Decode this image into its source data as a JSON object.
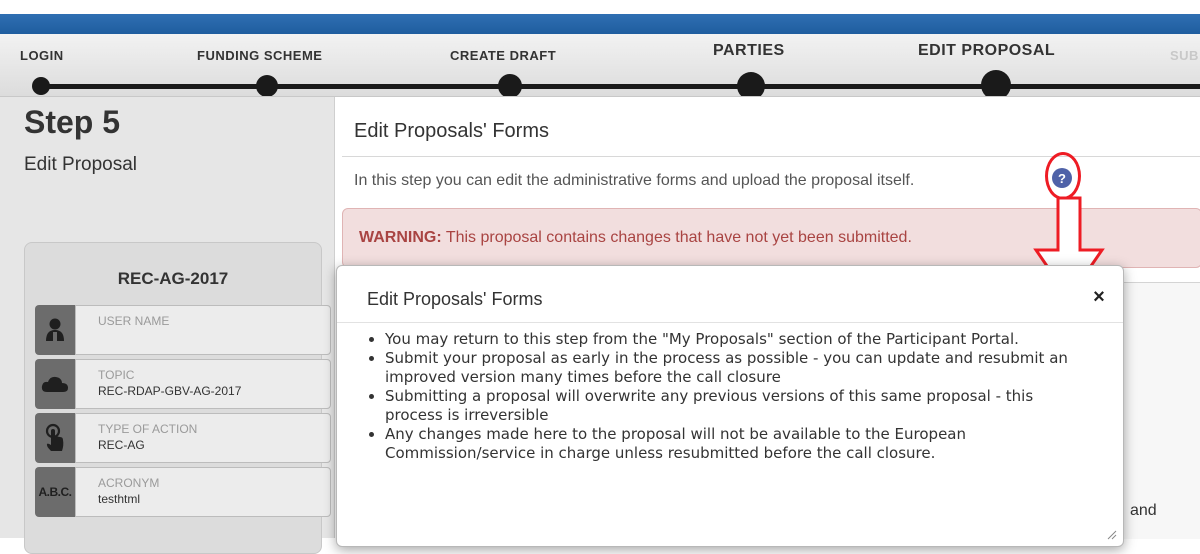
{
  "wizard": {
    "steps": [
      {
        "label": "LOGIN"
      },
      {
        "label": "FUNDING SCHEME"
      },
      {
        "label": "CREATE DRAFT"
      },
      {
        "label": "PARTIES"
      },
      {
        "label": "EDIT PROPOSAL"
      },
      {
        "label": "SUB"
      }
    ]
  },
  "sidebar": {
    "step_title": "Step 5",
    "step_subtitle": "Edit Proposal",
    "card": {
      "code": "REC-AG-2017",
      "fields": [
        {
          "icon": "user-icon",
          "label": "USER NAME",
          "value": ""
        },
        {
          "icon": "cloud-icon",
          "label": "TOPIC",
          "value": "REC-RDAP-GBV-AG-2017"
        },
        {
          "icon": "touch-icon",
          "label": "TYPE OF ACTION",
          "value": "REC-AG"
        },
        {
          "icon": "abc-icon",
          "label": "ACRONYM",
          "value": "testhtml",
          "icon_text": "A.B.C."
        }
      ]
    }
  },
  "main": {
    "title": "Edit Proposals' Forms",
    "description": "In this step you can edit the administrative forms and upload the proposal itself.",
    "warning_label": "WARNING:",
    "warning_text": "This proposal contains changes that have not yet been submitted.",
    "trailing_text": "and"
  },
  "modal": {
    "title": "Edit Proposals' Forms",
    "close_glyph": "×",
    "items": [
      "You may return to this step from the \"My Proposals\" section of the Participant Portal.",
      "Submit your proposal as early in the process as possible - you can update and resubmit an improved version many times before the call closure",
      "Submitting a proposal will overwrite any previous versions of this same proposal - this process is irreversible",
      "Any changes made here to the proposal will not be available to the European Commission/service in charge unless resubmitted before the call closure."
    ]
  },
  "help_glyph": "?",
  "colors": {
    "accent_blue": "#2f6fb3",
    "warning_text": "#a94442",
    "warning_bg": "#f2dede",
    "annotation_red": "#ee1c24"
  }
}
